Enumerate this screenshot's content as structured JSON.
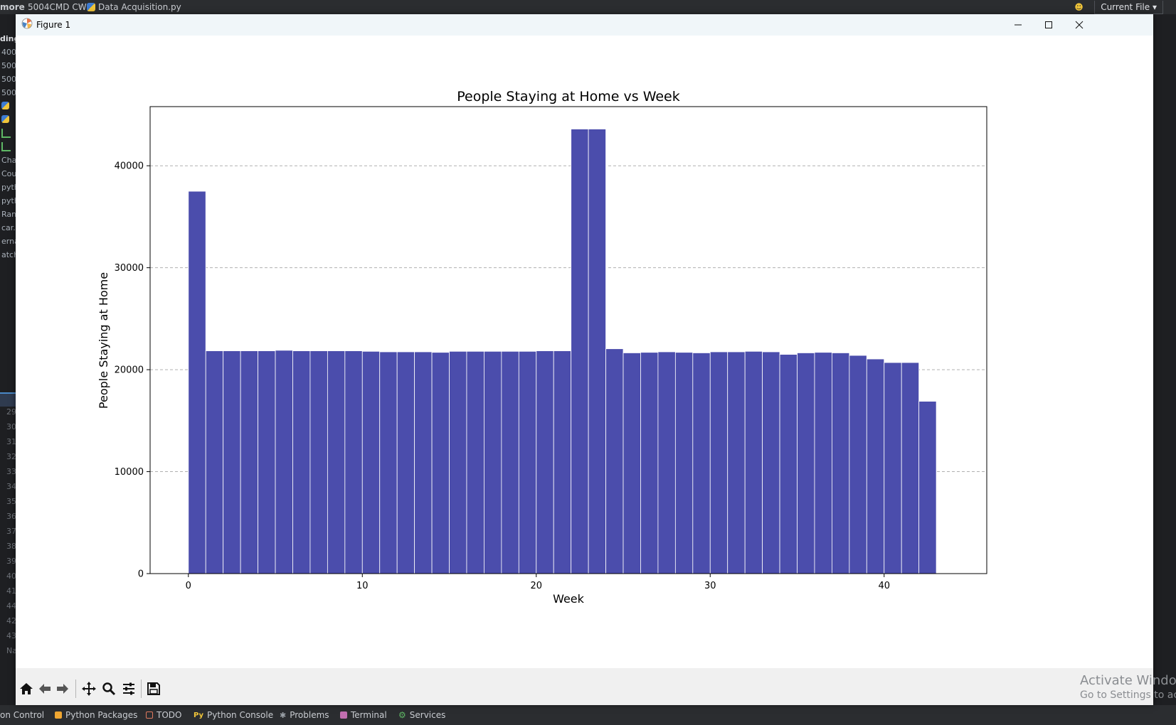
{
  "ide": {
    "breadcrumb": [
      "more",
      "5004CMD CW",
      "Data Acquisition.py"
    ],
    "run_config": "Current File",
    "left_rows": [
      "ding",
      "400",
      "500",
      "500",
      "500",
      "",
      "",
      "",
      "",
      "Cha",
      "Cou",
      "pyth",
      "pyth",
      "Ran",
      "car.",
      "erna",
      "atch"
    ],
    "line_numbers": [
      "29",
      "30",
      "31",
      "32",
      "33",
      "34",
      "35",
      "36",
      "37",
      "38",
      "39",
      "40",
      "41",
      "44",
      "42",
      "43",
      "Na"
    ],
    "bottom_tabs": [
      "on Control",
      "Python Packages",
      "TODO",
      "Python Console",
      "Problems",
      "Terminal",
      "Services"
    ],
    "watermark_line1": "Activate Windo",
    "watermark_line2": "Go to Settings to ac"
  },
  "window": {
    "title": "Figure 1"
  },
  "toolbar": {
    "buttons": [
      "home-icon",
      "back-icon",
      "forward-icon",
      "pan-icon",
      "zoom-icon",
      "configure-subplots-icon",
      "save-icon"
    ]
  },
  "chart_data": {
    "type": "bar",
    "title": "People Staying at Home vs Week",
    "xlabel": "Week",
    "ylabel": "People Staying at Home",
    "x": [
      0,
      1,
      2,
      3,
      4,
      5,
      6,
      7,
      8,
      9,
      10,
      11,
      12,
      13,
      14,
      15,
      16,
      17,
      18,
      19,
      20,
      21,
      22,
      23,
      24,
      25,
      26,
      27,
      28,
      29,
      30,
      31,
      32,
      33,
      34,
      35,
      36,
      37,
      38,
      39,
      40,
      41,
      42,
      43
    ],
    "values": [
      37500,
      21850,
      21850,
      21850,
      21850,
      21900,
      21850,
      21850,
      21850,
      21850,
      21800,
      21750,
      21750,
      21750,
      21700,
      21800,
      21800,
      21800,
      21800,
      21800,
      21850,
      21850,
      43600,
      43600,
      22050,
      21650,
      21700,
      21750,
      21700,
      21650,
      21750,
      21750,
      21800,
      21750,
      21500,
      21650,
      21700,
      21650,
      21400,
      21050,
      20700,
      20700,
      16900
    ],
    "xticks": [
      0,
      10,
      20,
      30,
      40
    ],
    "yticks": [
      0,
      10000,
      20000,
      30000,
      40000
    ],
    "xlim": [
      -2.2,
      45.9
    ],
    "ylim": [
      0,
      45800
    ],
    "bar_color": "#4b4dac",
    "grid": "y-dashed"
  }
}
